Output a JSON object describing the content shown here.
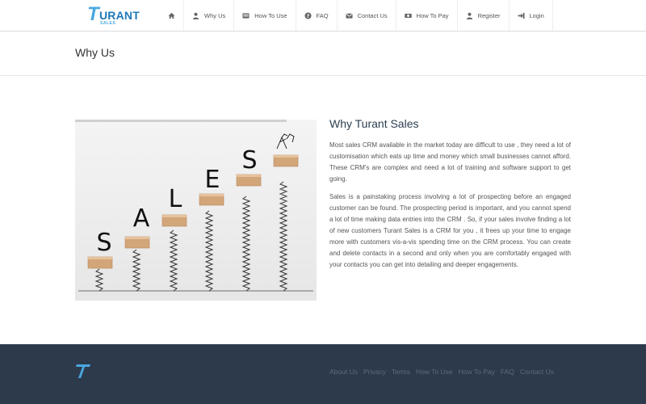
{
  "brand": {
    "logo_text": "URANT",
    "logo_initial": "T",
    "logo_sub": "SALES",
    "accent": "#4aa8e0",
    "accent_dark": "#1f79b8"
  },
  "nav": {
    "items": [
      {
        "icon": "home-icon",
        "label": ""
      },
      {
        "icon": "user-icon",
        "label": "Why Us"
      },
      {
        "icon": "list-icon",
        "label": "How To Use"
      },
      {
        "icon": "question-circle-icon",
        "label": "FAQ"
      },
      {
        "icon": "envelope-icon",
        "label": "Contact Us"
      },
      {
        "icon": "money-icon",
        "label": "How To Pay"
      },
      {
        "icon": "user-icon",
        "label": "Register"
      },
      {
        "icon": "sign-in-icon",
        "label": "Login"
      }
    ]
  },
  "page": {
    "title": "Why Us"
  },
  "hero": {
    "letters": [
      "S",
      "A",
      "L",
      "E",
      "S"
    ]
  },
  "main": {
    "heading": "Why Turant Sales",
    "paragraphs": [
      "Most sales CRM available in the market today are difficult to use , they need a lot of customisation which eats up time and money which small businesses cannot afford. These CRM's are complex and need a lot of training and software support to get going.",
      "Sales is a painstaking process involving a lot of prospecting before an engaged customer can be found. The prospecting period is important, and you cannot spend a lot of time making data entries into the CRM . So, if your sales involve finding a lot of new customers Turant Sales is a CRM for you , it frees up your time to engage more with customers vis-a-vis spending time on the CRM process. You can create and delete contacts in a second and only when you are comfortably engaged with your contacts you can get into detailing and deeper engagements."
    ]
  },
  "footer": {
    "bg": "#2d3a4c",
    "links": [
      "About Us",
      "Privacy",
      "Terms",
      "How To Use",
      "How To Pay",
      "FAQ",
      "Contact Us"
    ]
  }
}
